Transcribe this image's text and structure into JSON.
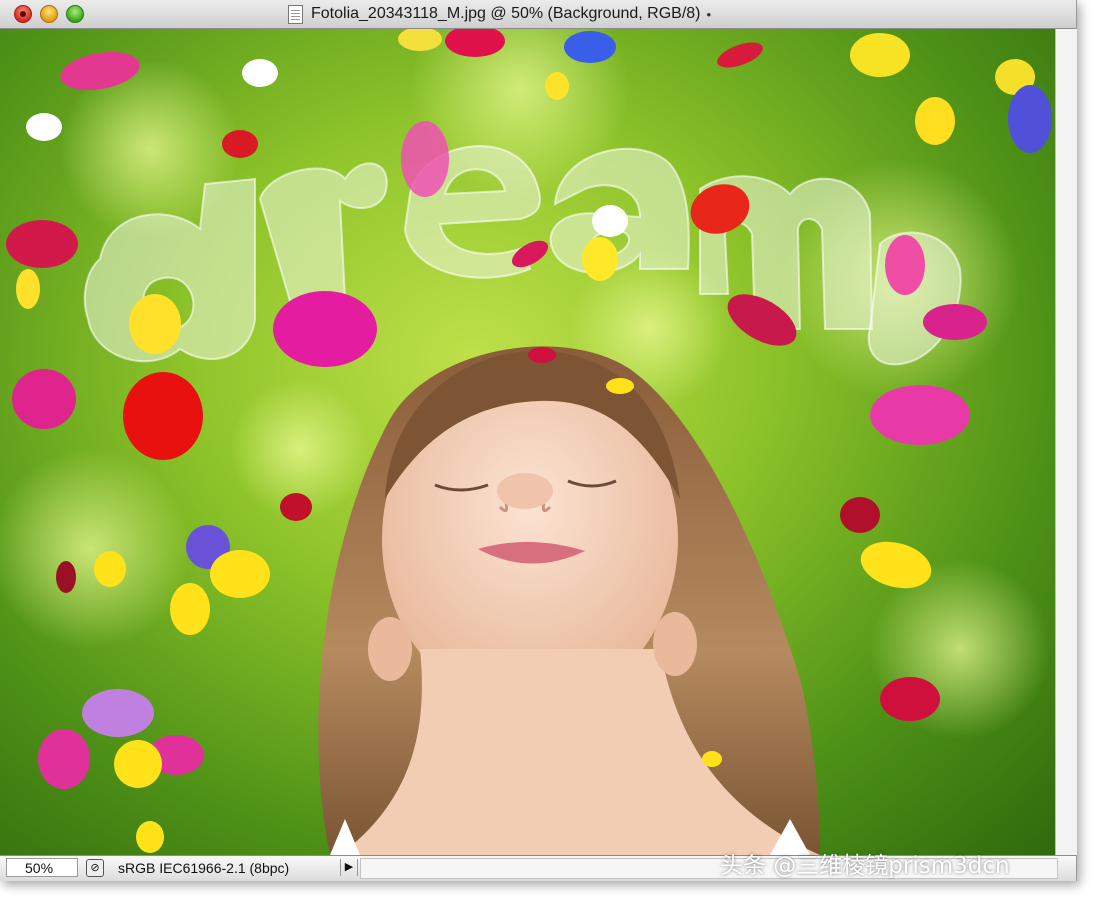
{
  "window": {
    "title": "Fotolia_20343118_M.jpg @ 50% (Background, RGB/8)",
    "unsaved_marker": "•"
  },
  "canvas": {
    "text_layer": "dream"
  },
  "statusbar": {
    "zoom": "50%",
    "profile": "sRGB IEC61966-2.1 (8bpc)",
    "menu_arrow": "▶"
  },
  "watermark": "头条 @三维棱镜prism3dcn",
  "colors": {
    "close": "#d12c1d",
    "minimize": "#e49a10",
    "maximize": "#3aa51c",
    "grass": "#6fae22",
    "text_fill": "#e8f0d8"
  },
  "icons": {
    "document": "doc-icon",
    "status_proof": "proof-icon",
    "status_menu": "play-triangle-icon"
  }
}
